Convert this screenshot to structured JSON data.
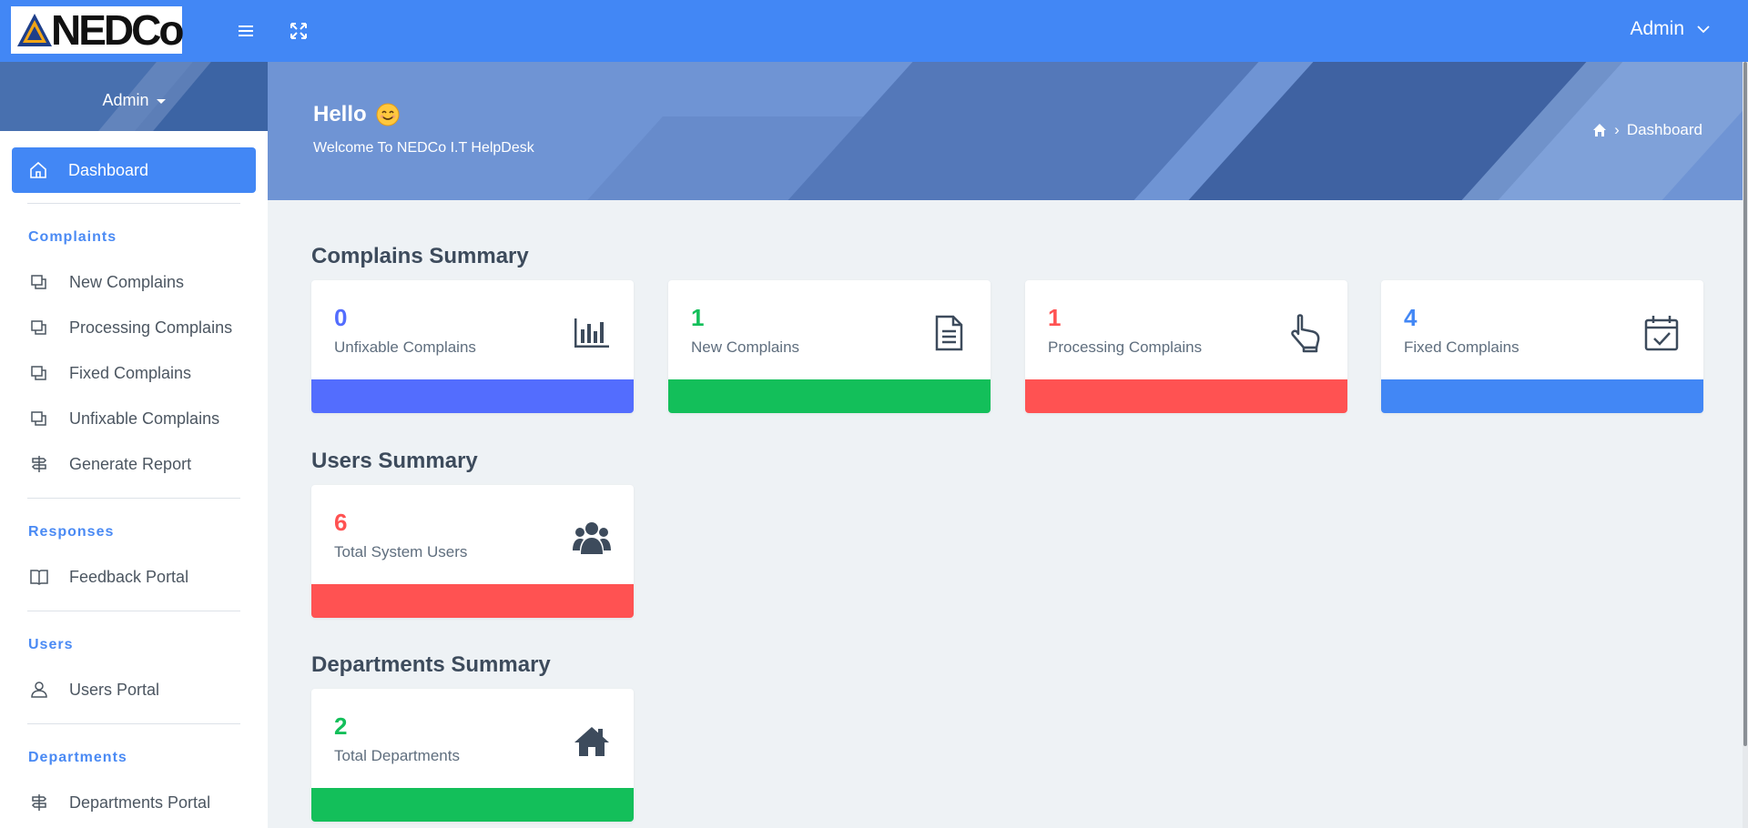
{
  "header": {
    "logo_text": "NEDCo",
    "user_label": "Admin",
    "icons": [
      "menu-icon",
      "expand-icon",
      "chevron-down-icon"
    ]
  },
  "sidebar": {
    "user_label": "Admin",
    "active_item": {
      "label": "Dashboard",
      "icon": "home-icon"
    },
    "sections": [
      {
        "title": "Complaints",
        "items": [
          {
            "label": "New Complains",
            "icon": "copy-icon"
          },
          {
            "label": "Processing Complains",
            "icon": "copy-icon"
          },
          {
            "label": "Fixed Complains",
            "icon": "copy-icon"
          },
          {
            "label": "Unfixable Complains",
            "icon": "copy-icon"
          },
          {
            "label": "Generate Report",
            "icon": "signpost-icon"
          }
        ]
      },
      {
        "title": "Responses",
        "items": [
          {
            "label": "Feedback Portal",
            "icon": "book-icon"
          }
        ]
      },
      {
        "title": "Users",
        "items": [
          {
            "label": "Users Portal",
            "icon": "user-icon"
          }
        ]
      },
      {
        "title": "Departments",
        "items": [
          {
            "label": "Departments Portal",
            "icon": "signpost-icon"
          }
        ]
      }
    ]
  },
  "banner": {
    "greeting": "Hello",
    "welcome": "Welcome To NEDCo I.T HelpDesk",
    "breadcrumb_sep": "›",
    "breadcrumb_current": "Dashboard"
  },
  "complains_summary": {
    "title": "Complains Summary",
    "cards": [
      {
        "value": "0",
        "label": "Unfixable Complains",
        "icon": "bar-chart-icon",
        "color": "#536dfe"
      },
      {
        "value": "1",
        "label": "New Complains",
        "icon": "document-icon",
        "color": "#13bf5a"
      },
      {
        "value": "1",
        "label": "Processing Complains",
        "icon": "pointer-hand-icon",
        "color": "#ff5252"
      },
      {
        "value": "4",
        "label": "Fixed Complains",
        "icon": "calendar-check-icon",
        "color": "#4287f5"
      }
    ]
  },
  "users_summary": {
    "title": "Users Summary",
    "card": {
      "value": "6",
      "label": "Total System Users",
      "icon": "users-icon",
      "color": "#ff5252"
    }
  },
  "departments_summary": {
    "title": "Departments Summary",
    "card": {
      "value": "2",
      "label": "Total Departments",
      "icon": "house-icon",
      "color": "#13bf5a"
    }
  },
  "colors": {
    "topbar": "#4287f5",
    "accent": "#4287f5",
    "page_bg": "#eef2f5"
  }
}
